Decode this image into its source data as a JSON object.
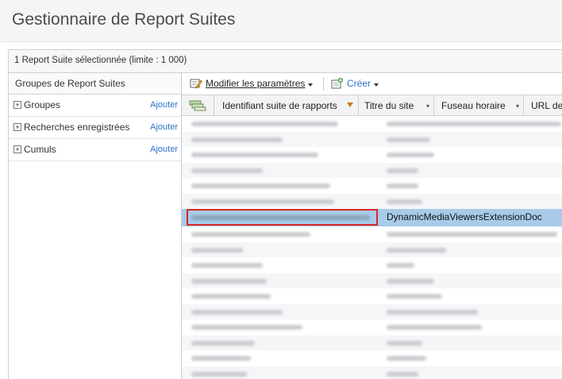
{
  "page": {
    "title": "Gestionnaire de Report Suites"
  },
  "selection": {
    "text": "1 Report Suite sélectionnée (limite : 1 000)"
  },
  "groups_panel": {
    "header": "Groupes de Report Suites",
    "items": [
      {
        "label": "Groupes",
        "action": "Ajouter"
      },
      {
        "label": "Recherches enregistrées",
        "action": "Ajouter"
      },
      {
        "label": "Cumuls",
        "action": "Ajouter"
      }
    ]
  },
  "toolbar": {
    "edit_settings": "Modifier les paramètres",
    "create": "Créer"
  },
  "table": {
    "columns": [
      "Identifiant suite de rapports",
      "Titre du site",
      "Fuseau horaire",
      "URL de"
    ],
    "selected_row_site_title": "DynamicMediaViewersExtensionDoc"
  },
  "colors": {
    "selected_row": "#a8cbe9",
    "highlight_border": "#d9262b",
    "link": "#2a73c7"
  }
}
